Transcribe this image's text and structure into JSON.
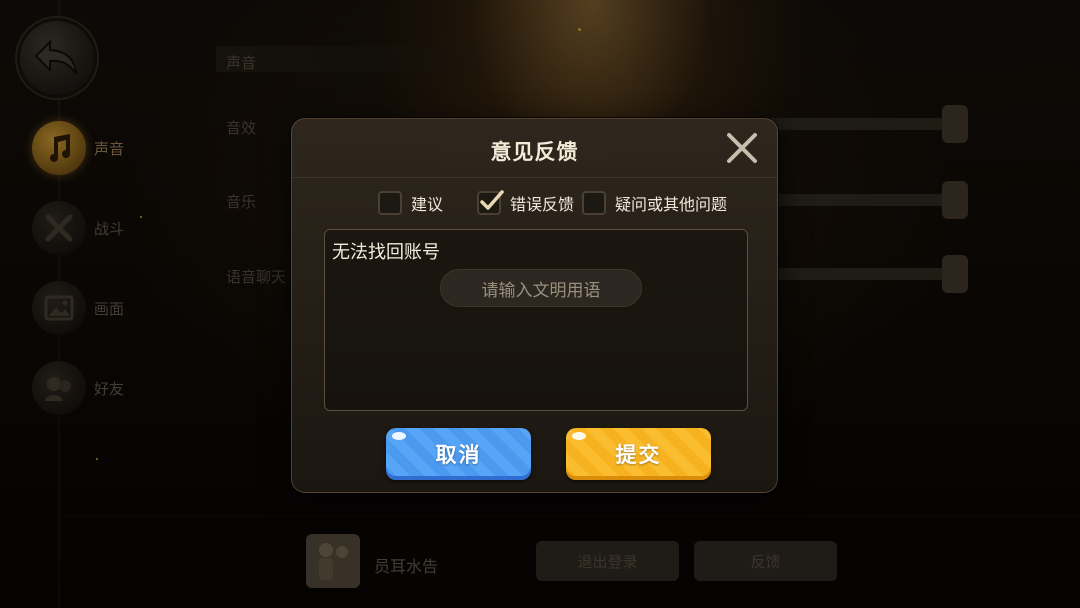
{
  "sidebar": {
    "items": [
      {
        "label": "声音",
        "icon": "music-note-icon",
        "active": true
      },
      {
        "label": "战斗",
        "icon": "crossed-swords-icon",
        "active": false
      },
      {
        "label": "画面",
        "icon": "picture-icon",
        "active": false
      },
      {
        "label": "好友",
        "icon": "friends-icon",
        "active": false
      }
    ]
  },
  "settings": {
    "section": "声音",
    "rows": [
      "音效",
      "音乐",
      "语音聊天"
    ]
  },
  "footer": {
    "player_name": "员耳水告",
    "logout_label": "退出登录",
    "feedback_label": "反馈"
  },
  "dialog": {
    "title": "意见反馈",
    "options": [
      {
        "label": "建议",
        "checked": false
      },
      {
        "label": "错误反馈",
        "checked": true
      },
      {
        "label": "疑问或其他问题",
        "checked": false
      }
    ],
    "input_value": "无法找回账号",
    "placeholder": "请输入文明用语",
    "cancel_label": "取消",
    "submit_label": "提交"
  },
  "colors": {
    "cancel": "#4b9af0",
    "submit": "#f7b31f",
    "active_icon": "#b98b2e"
  }
}
